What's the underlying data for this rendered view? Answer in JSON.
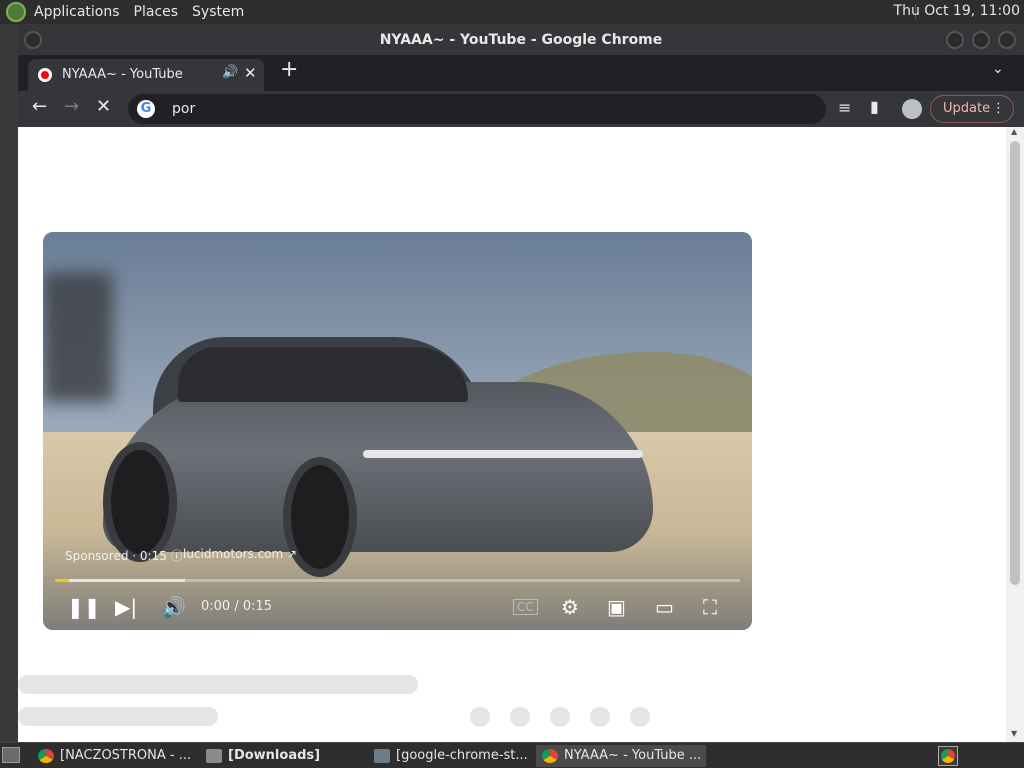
{
  "top_panel": {
    "menus": [
      "Applications",
      "Places",
      "System"
    ],
    "clock": "Thu Oct 19, 11:00"
  },
  "window": {
    "title": "NYAAA~ - YouTube - Google Chrome"
  },
  "tab": {
    "title": "NYAAA~ - YouTube",
    "audio_icon": "🔊",
    "close": "✕",
    "new_tab": "+"
  },
  "toolbar": {
    "address_value": "por",
    "update_label": "Update"
  },
  "player": {
    "sponsored": "Sponsored · 0:15 ⓘ",
    "sponsor_link": "lucidmotors.com ↗",
    "time": "0:00 / 0:15",
    "progress": 0.02,
    "progress_color": "#f5c518"
  },
  "taskbar": {
    "items": [
      {
        "label": "[NACZOSTRONA - ...",
        "icon": "chrome-icon"
      },
      {
        "label": "[Downloads]",
        "icon": "folder-icon"
      },
      {
        "label": "[google-chrome-st...",
        "icon": "archive-icon"
      },
      {
        "label": "NYAAA~ - YouTube ...",
        "icon": "chrome-icon"
      }
    ]
  }
}
